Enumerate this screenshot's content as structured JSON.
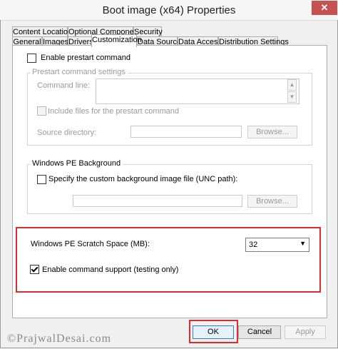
{
  "window": {
    "title": "Boot image (x64) Properties",
    "close_glyph": "✕"
  },
  "tabs_row1": [
    "Content Locations",
    "Optional Components",
    "Security"
  ],
  "tabs_row2": [
    "General",
    "Images",
    "Drivers",
    "Customization",
    "Data Source",
    "Data Access",
    "Distribution Settings"
  ],
  "active_tab": "Customization",
  "prestart": {
    "enable_label": "Enable prestart command",
    "enable_checked": false,
    "group_title": "Prestart command settings",
    "command_line_label": "Command line:",
    "command_line_value": "",
    "include_files_label": "Include files for the prestart command",
    "include_files_checked": false,
    "source_dir_label": "Source directory:",
    "source_dir_value": "",
    "browse_label": "Browse..."
  },
  "background": {
    "group_title": "Windows PE Background",
    "specify_label": "Specify the custom background image file (UNC path):",
    "specify_checked": false,
    "path_value": "",
    "browse_label": "Browse..."
  },
  "scratch": {
    "label": "Windows PE Scratch Space (MB):",
    "value": "32"
  },
  "command_support": {
    "label": "Enable command support (testing only)",
    "checked": true
  },
  "buttons": {
    "ok": "OK",
    "cancel": "Cancel",
    "apply": "Apply"
  },
  "watermark": "©PrajwalDesai.com",
  "colors": {
    "highlight_box": "#d92e2e",
    "close_button": "#c75050"
  }
}
